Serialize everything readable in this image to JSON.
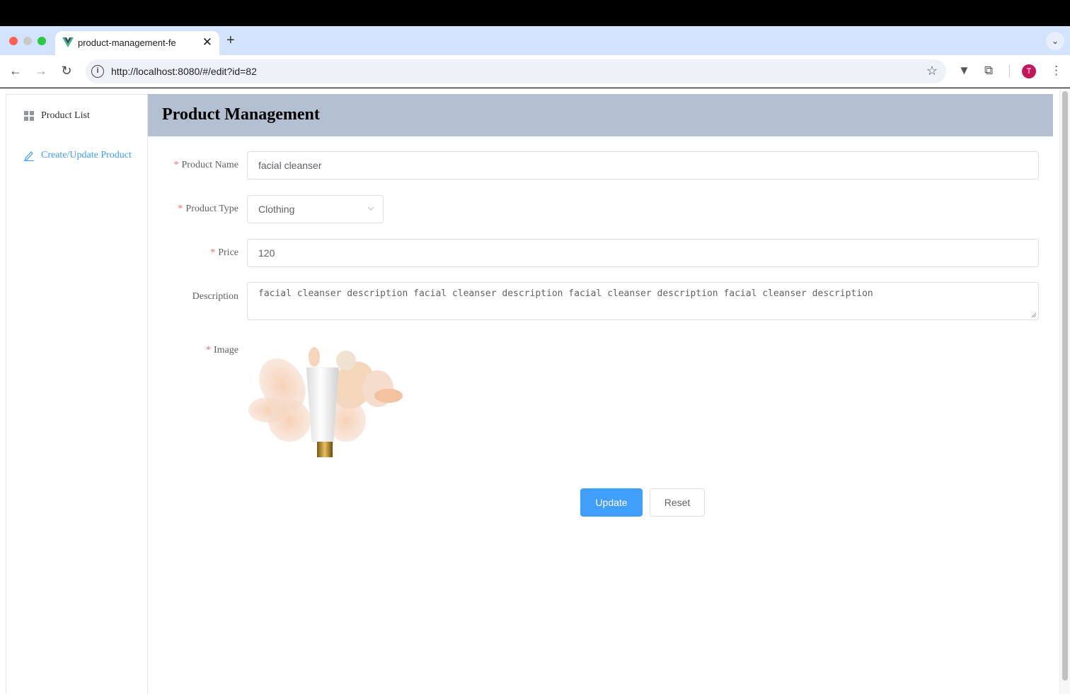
{
  "browser": {
    "tab_title": "product-management-fe",
    "url": "http://localhost:8080/#/edit?id=82",
    "profile_initial": "T",
    "new_tab_label": "+",
    "close_label": "✕"
  },
  "sidebar": {
    "items": [
      {
        "label": "Product List",
        "icon": "grid-icon",
        "active": false
      },
      {
        "label": "Create/Update Product",
        "icon": "edit-icon",
        "active": true
      }
    ]
  },
  "header": {
    "title": "Product Management"
  },
  "form": {
    "name": {
      "label": "Product Name",
      "value": "facial cleanser",
      "required": true
    },
    "type": {
      "label": "Product Type",
      "value": "Clothing",
      "required": true
    },
    "price": {
      "label": "Price",
      "value": "120",
      "required": true
    },
    "description": {
      "label": "Description",
      "value": "facial cleanser description facial cleanser description facial cleanser description facial cleanser description",
      "required": false
    },
    "image": {
      "label": "Image",
      "required": true
    },
    "required_mark": "*"
  },
  "buttons": {
    "update": "Update",
    "reset": "Reset"
  },
  "colors": {
    "primary": "#409eff",
    "header_bg": "#b3c0d1",
    "required": "#f56c6c"
  }
}
